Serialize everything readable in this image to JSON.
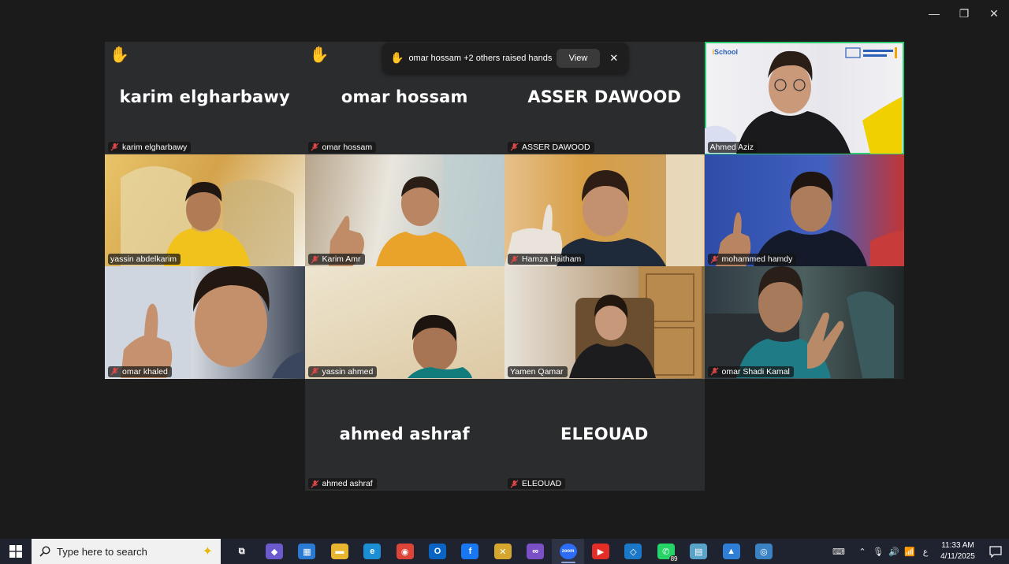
{
  "window": {
    "minimize": "—",
    "restore": "❐",
    "close": "✕"
  },
  "notification": {
    "text": "omar hossam +2 others raised hands",
    "view_label": "View",
    "close_label": "✕"
  },
  "participants": [
    {
      "name": "karim elgharbawy",
      "video": false,
      "raised_hand": true
    },
    {
      "name": "omar hossam",
      "video": false,
      "raised_hand": true
    },
    {
      "name": "ASSER DAWOOD",
      "video": false,
      "raised_hand": false
    },
    {
      "name": "Ahmed Aziz",
      "video": true,
      "host": true,
      "active_speaker": true
    },
    {
      "name": "yassin abdelkarim",
      "video": true
    },
    {
      "name": "Karim Amr",
      "video": true
    },
    {
      "name": "Hamza Haitham",
      "video": true
    },
    {
      "name": "mohammed hamdy",
      "video": true
    },
    {
      "name": "omar khaled",
      "video": true
    },
    {
      "name": "yassin ahmed",
      "video": true
    },
    {
      "name": "Yamen Qamar",
      "video": true
    },
    {
      "name": "omar Shadi Kamal",
      "video": true
    },
    {
      "name": "ahmed ashraf",
      "video": false
    },
    {
      "name": "ELEOUAD",
      "video": false
    }
  ],
  "host_logo": {
    "brand_prefix": "i",
    "brand": "School"
  },
  "taskbar": {
    "search_placeholder": "Type here to search",
    "apps": [
      {
        "name": "task-view",
        "glyph": "⧉",
        "color": "#1f2330"
      },
      {
        "name": "copilot",
        "glyph": "◆",
        "color": "#6a5acd"
      },
      {
        "name": "microsoft-store",
        "glyph": "▦",
        "color": "#2a7ad4"
      },
      {
        "name": "file-explorer",
        "glyph": "▬",
        "color": "#e8b530"
      },
      {
        "name": "edge",
        "glyph": "e",
        "color": "#1b8fd6"
      },
      {
        "name": "chrome",
        "glyph": "◉",
        "color": "#db4437"
      },
      {
        "name": "outlook",
        "glyph": "O",
        "color": "#0a64c4"
      },
      {
        "name": "facebook",
        "glyph": "f",
        "color": "#1877f2"
      },
      {
        "name": "maps",
        "glyph": "✕",
        "color": "#d6a72e"
      },
      {
        "name": "visual-studio",
        "glyph": "∞",
        "color": "#7b4fc6"
      },
      {
        "name": "zoom",
        "glyph": "zoom",
        "color": "#2d6cf5",
        "active": true
      },
      {
        "name": "youtube",
        "glyph": "▶",
        "color": "#e52d27"
      },
      {
        "name": "vscode",
        "glyph": "◇",
        "color": "#1b78c9"
      },
      {
        "name": "whatsapp",
        "glyph": "✆",
        "color": "#25d366",
        "badge": "89"
      },
      {
        "name": "notes",
        "glyph": "▤",
        "color": "#5aa3c8"
      },
      {
        "name": "photos",
        "glyph": "▲",
        "color": "#2f7fd8"
      },
      {
        "name": "vpn",
        "glyph": "◎",
        "color": "#3b82c4"
      }
    ],
    "tray": {
      "language": "ع",
      "time": "11:33 AM",
      "date": "4/11/2025"
    }
  }
}
